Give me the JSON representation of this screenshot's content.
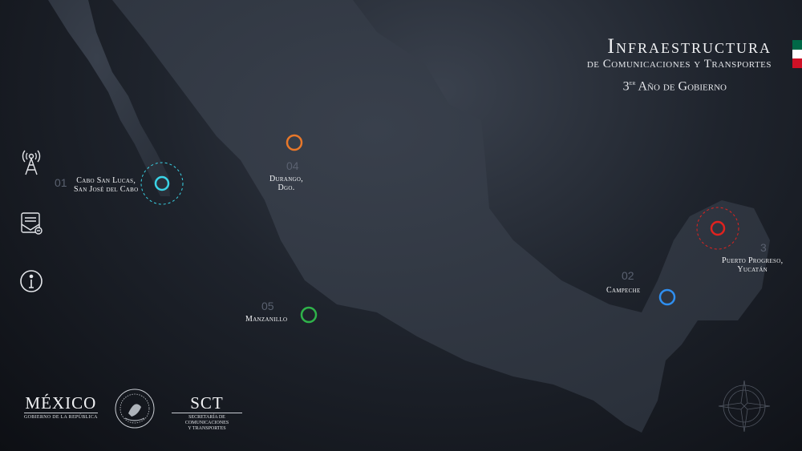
{
  "header": {
    "title": "Infraestructura",
    "subtitle": "de Comunicaciones y Transportes",
    "year_prefix": "3",
    "year_sup": "er",
    "year_rest": " Año de Gobierno"
  },
  "flag_colors": [
    "#006847",
    "#ffffff",
    "#ce1126"
  ],
  "sidebar": {
    "items": [
      {
        "icon": "antenna-tower-icon"
      },
      {
        "icon": "mail-document-icon"
      },
      {
        "icon": "info-icon"
      }
    ]
  },
  "markers": [
    {
      "num": "01",
      "label_line1": "Cabo San Lucas,",
      "label_line2": "San José del Cabo",
      "color": "#3ad3e6"
    },
    {
      "num": "02",
      "label_line1": "Campeche",
      "label_line2": "",
      "color": "#2f8ff0"
    },
    {
      "num": "3",
      "label_line1": "Puerto Progreso,",
      "label_line2": "Yucatán",
      "color": "#e0221f"
    },
    {
      "num": "04",
      "label_line1": "Durango,",
      "label_line2": "Dgo.",
      "color": "#e8782a"
    },
    {
      "num": "05",
      "label_line1": "Manzanillo",
      "label_line2": "",
      "color": "#2fb34a"
    }
  ],
  "footer": {
    "mexico_title": "MÉXICO",
    "mexico_sub": "GOBIERNO DE LA REPÚBLICA",
    "sct_title": "SCT",
    "sct_sub_line1": "SECRETARÍA DE",
    "sct_sub_line2": "COMUNICACIONES",
    "sct_sub_line3": "Y TRANSPORTES"
  }
}
